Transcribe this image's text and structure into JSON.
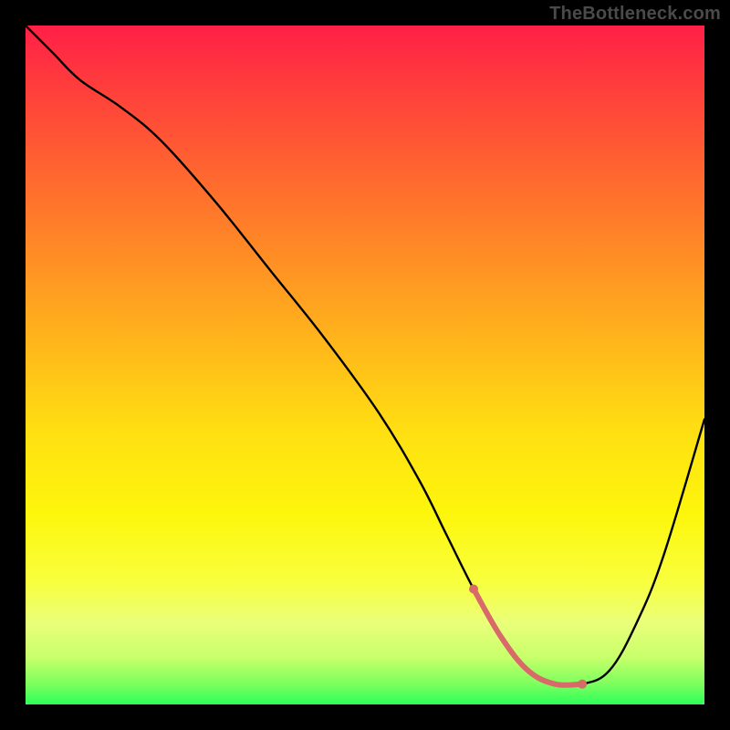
{
  "watermark": "TheBottleneck.com",
  "colors": {
    "page_bg": "#000000",
    "watermark": "#4a4a4a",
    "curve": "#000000",
    "trough_highlight": "#d86a6a",
    "gradient_top": "#ff1f47",
    "gradient_bottom": "#2cff5a"
  },
  "chart_data": {
    "type": "line",
    "title": "",
    "xlabel": "",
    "ylabel": "",
    "x_range": [
      0,
      100
    ],
    "y_range": [
      0,
      100
    ],
    "note": "Gradient background encodes y from red (top, y≈100) to green (bottom, y≈0). Curve drawn over it; values estimated from shape.",
    "series": [
      {
        "name": "bottleneck-curve",
        "x": [
          0,
          4,
          8,
          14,
          20,
          28,
          36,
          44,
          52,
          58,
          62,
          66,
          70,
          74,
          78,
          82,
          86,
          90,
          94,
          100
        ],
        "y": [
          100,
          96,
          92,
          88,
          83,
          74,
          64,
          54,
          43,
          33,
          25,
          17,
          10,
          5,
          3,
          3,
          5,
          12,
          22,
          42
        ]
      }
    ],
    "trough_highlight": {
      "x_start": 66,
      "x_end": 84,
      "approx_y": 3
    }
  }
}
